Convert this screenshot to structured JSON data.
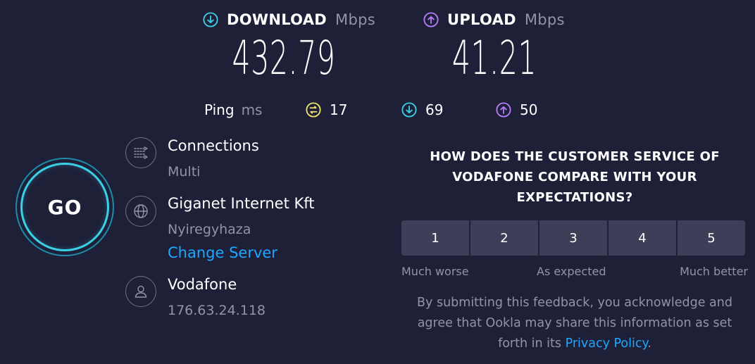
{
  "download": {
    "label": "DOWNLOAD",
    "unit": "Mbps",
    "value": "432.79",
    "icon": "download-arrow-icon",
    "color": "#3ad0e6"
  },
  "upload": {
    "label": "UPLOAD",
    "unit": "Mbps",
    "value": "41.21",
    "icon": "upload-arrow-icon",
    "color": "#b57ef8"
  },
  "ping": {
    "label": "Ping",
    "unit": "ms",
    "idle": "17",
    "idle_color": "#f2e46c",
    "download": "69",
    "download_color": "#3ad0e6",
    "upload": "50",
    "upload_color": "#b57ef8"
  },
  "go_button": {
    "label": "GO"
  },
  "connections": {
    "title": "Connections",
    "value": "Multi",
    "icon": "connections-icon"
  },
  "server": {
    "name": "Giganet Internet Kft",
    "location": "Nyiregyhaza",
    "change_label": "Change Server",
    "icon": "globe-icon"
  },
  "provider": {
    "name": "Vodafone",
    "ip": "176.63.24.118",
    "icon": "user-icon"
  },
  "survey": {
    "question_line1": "HOW DOES THE CUSTOMER SERVICE OF",
    "question_line2": "VODAFONE COMPARE WITH YOUR",
    "question_line3": "EXPECTATIONS?",
    "options": [
      "1",
      "2",
      "3",
      "4",
      "5"
    ],
    "scale_low": "Much worse",
    "scale_mid": "As expected",
    "scale_high": "Much better",
    "disclaimer_line1": "By submitting this feedback, you acknowledge and",
    "disclaimer_line2": "agree that Ookla may share this information as set",
    "disclaimer_line3_prefix": "forth in its",
    "privacy_link": "Privacy Policy",
    "disclaimer_suffix": "."
  }
}
